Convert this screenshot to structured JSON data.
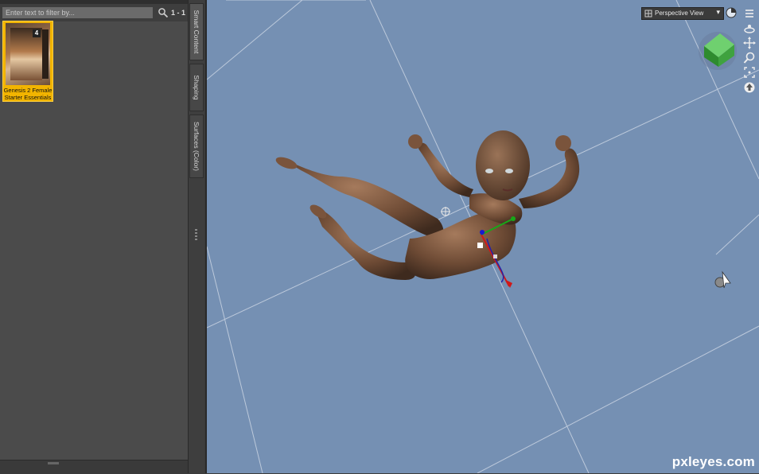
{
  "content_library": {
    "filter_placeholder": "Enter text to filter by...",
    "result_count": "1 - 1",
    "product": {
      "name": "Genesis 2 Female\nStarter Essentials",
      "badge": "4"
    }
  },
  "side_tabs": [
    {
      "label": "Smart Content"
    },
    {
      "label": "Shaping"
    },
    {
      "label": "Surfaces (Color)"
    }
  ],
  "viewport": {
    "view_select": "Perspective View",
    "background_color": "#7590b3"
  },
  "watermark": "pxleyes.com"
}
